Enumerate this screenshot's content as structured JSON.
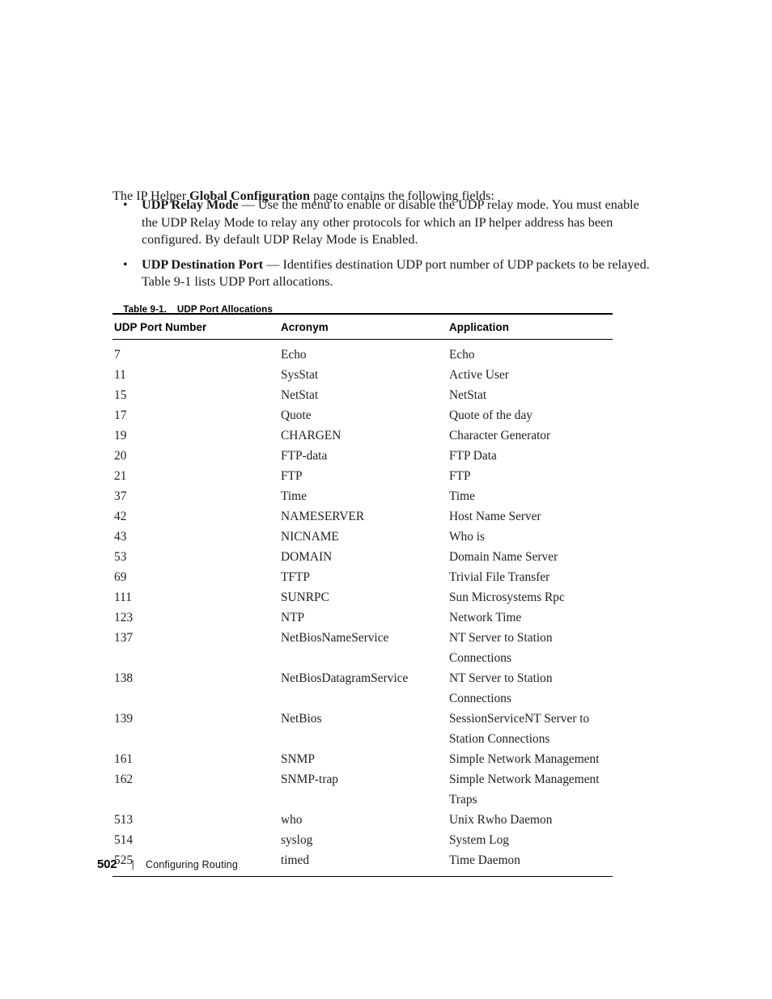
{
  "document": {
    "intro": {
      "before_bold": "The IP Helper ",
      "bold": "Global Configuration",
      "after_bold": " page contains the following fields:"
    },
    "bullets": [
      {
        "marker": "•",
        "term": "UDP Relay Mode",
        "separator": " — ",
        "description": "Use the menu to enable or disable the UDP relay mode. You must enable the UDP Relay Mode to relay any other protocols for which an IP helper address has been configured. By default UDP Relay Mode is Enabled."
      },
      {
        "marker": "•",
        "term": "UDP Destination Port",
        "separator": " — ",
        "description": "Identifies destination UDP port number of UDP packets to be relayed. Table 9-1 lists UDP Port allocations."
      }
    ],
    "table": {
      "caption_number": "Table 9-1.",
      "caption_title": "UDP Port Allocations",
      "columns": [
        "UDP Port Number",
        "Acronym",
        "Application"
      ],
      "rows": [
        {
          "port": "7",
          "acronym": "Echo",
          "application": "Echo"
        },
        {
          "port": "11",
          "acronym": "SysStat",
          "application": "Active User"
        },
        {
          "port": "15",
          "acronym": "NetStat",
          "application": "NetStat"
        },
        {
          "port": "17",
          "acronym": "Quote",
          "application": "Quote of the day"
        },
        {
          "port": "19",
          "acronym": "CHARGEN",
          "application": "Character Generator"
        },
        {
          "port": "20",
          "acronym": "FTP-data",
          "application": "FTP Data"
        },
        {
          "port": "21",
          "acronym": "FTP",
          "application": "FTP"
        },
        {
          "port": "37",
          "acronym": "Time",
          "application": "Time"
        },
        {
          "port": "42",
          "acronym": "NAMESERVER",
          "application": "Host Name Server"
        },
        {
          "port": "43",
          "acronym": "NICNAME",
          "application": "Who is"
        },
        {
          "port": "53",
          "acronym": "DOMAIN",
          "application": "Domain Name Server"
        },
        {
          "port": "69",
          "acronym": "TFTP",
          "application": "Trivial File Transfer"
        },
        {
          "port": "111",
          "acronym": "SUNRPC",
          "application": "Sun Microsystems Rpc"
        },
        {
          "port": "123",
          "acronym": "NTP",
          "application": "Network Time"
        },
        {
          "port": "137",
          "acronym": "NetBiosNameService",
          "application": "NT Server to Station Connections"
        },
        {
          "port": "138",
          "acronym": "NetBiosDatagramService",
          "application": "NT Server to Station Connections"
        },
        {
          "port": "139",
          "acronym": "NetBios",
          "application": "SessionServiceNT Server to Station Connections"
        },
        {
          "port": "161",
          "acronym": "SNMP",
          "application": "Simple Network Management"
        },
        {
          "port": "162",
          "acronym": "SNMP-trap",
          "application": "Simple Network Management Traps"
        },
        {
          "port": "513",
          "acronym": "who",
          "application": "Unix Rwho Daemon"
        },
        {
          "port": "514",
          "acronym": "syslog",
          "application": "System Log"
        },
        {
          "port": "525",
          "acronym": "timed",
          "application": "Time Daemon"
        }
      ]
    },
    "footer": {
      "page_number": "502",
      "separator": "|",
      "chapter": "Configuring Routing"
    }
  }
}
